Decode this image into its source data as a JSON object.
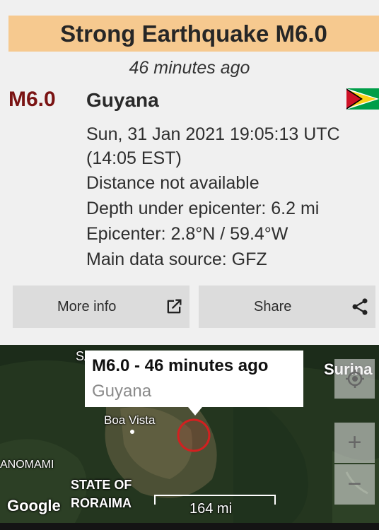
{
  "header": {
    "title": "Strong Earthquake M6.0",
    "time_ago": "46 minutes ago"
  },
  "quake": {
    "magnitude": "M6.0",
    "region": "Guyana",
    "flag_icon": "guyana-flag",
    "datetime": "Sun, 31 Jan 2021 19:05:13 UTC",
    "local_time": "(14:05 EST)",
    "distance": "Distance not available",
    "depth": "Depth under epicenter: 6.2 mi",
    "epicenter": "Epicenter: 2.8°N / 59.4°W",
    "source": "Main data source: GFZ"
  },
  "buttons": {
    "more_info": "More info",
    "share": "Share"
  },
  "map": {
    "popup_title": "M6.0  -  46 minutes ago",
    "popup_subtitle": "Guyana",
    "labels": {
      "boa_vista": "Boa Vista",
      "suriname": "Surina",
      "yanomami": "ANOMAMI",
      "state_of": "STATE OF",
      "roraima": "RORAIMA",
      "sa": "SA",
      "google": "Google"
    },
    "scale": "164 mi",
    "zoom_in": "+",
    "zoom_out": "−"
  },
  "colors": {
    "banner": "#f6c98f",
    "magnitude": "#7a1313",
    "epicenter_ring": "#d32020"
  }
}
